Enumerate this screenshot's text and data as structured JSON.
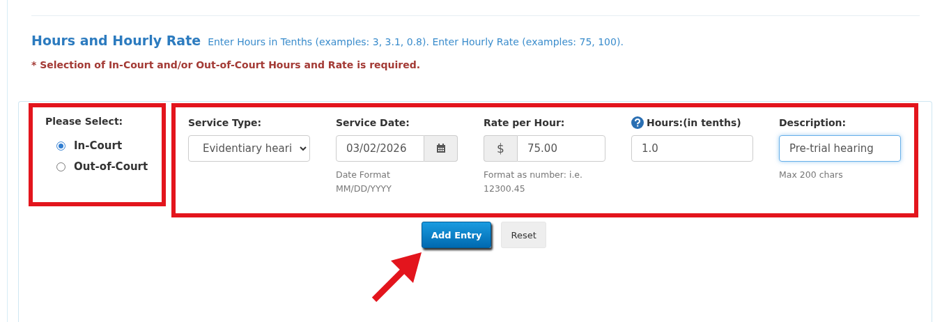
{
  "header": {
    "title": "Hours and Hourly Rate",
    "hint": "Enter Hours in Tenths (examples: 3, 3.1, 0.8).  Enter Hourly Rate (examples: 75, 100).",
    "required_note": "* Selection of In-Court and/or Out-of-Court Hours and Rate is required."
  },
  "selection": {
    "label": "Please Select:",
    "options": [
      {
        "label": "In-Court",
        "selected": true
      },
      {
        "label": "Out-of-Court",
        "selected": false
      }
    ]
  },
  "fields": [
    {
      "kind": "select",
      "label": "Service Type:",
      "value": "Evidentiary heari"
    },
    {
      "kind": "date",
      "label": "Service Date:",
      "value": "03/02/2026",
      "help": "Date Format\nMM/DD/YYYY"
    },
    {
      "kind": "currency",
      "label": "Rate per Hour:",
      "prefix": "$",
      "value": "75.00",
      "help": "Format as number: i.e.\n12300.45"
    },
    {
      "kind": "text",
      "label": "Hours:(in tenths)",
      "info": true,
      "value": "1.0"
    },
    {
      "kind": "text",
      "label": "Description:",
      "value": "Pre-trial hearing",
      "focused": true,
      "help": "Max 200 chars"
    }
  ],
  "buttons": [
    {
      "kind": "primary",
      "label": "Add Entry"
    },
    {
      "kind": "default",
      "label": "Reset"
    }
  ]
}
